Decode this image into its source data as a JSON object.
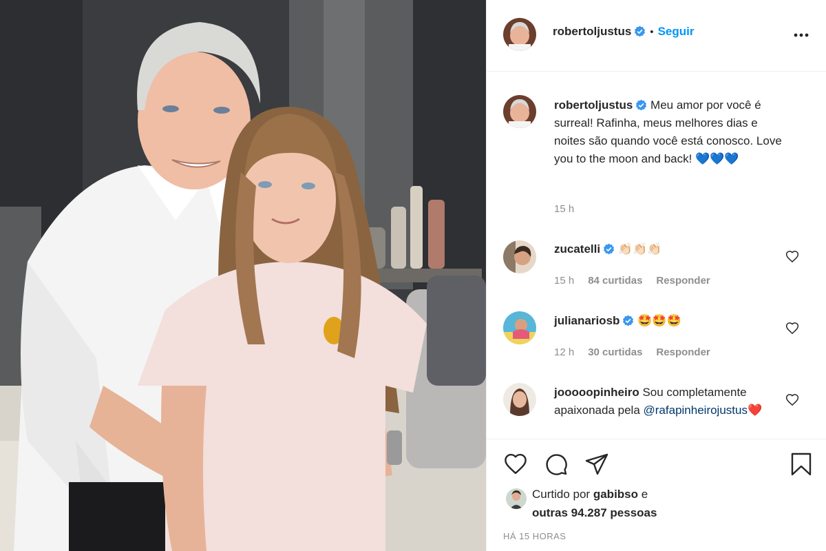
{
  "post": {
    "author": "robertoljustus",
    "follow_label": "Seguir",
    "separator": "•",
    "caption": "Meu amor por você é surreal! Rafinha, meus melhores dias e noites são quando você está conosco. Love you to the moon and back! 💙💙💙",
    "caption_time": "15 h"
  },
  "comments": [
    {
      "username": "zucatelli",
      "text": "👏🏻👏🏻👏🏻",
      "time": "15 h",
      "likes": "84 curtidas",
      "reply_label": "Responder"
    },
    {
      "username": "julianariosb",
      "text": "🤩🤩🤩",
      "time": "12 h",
      "likes": "30 curtidas",
      "reply_label": "Responder"
    },
    {
      "username": "jooooopinheiro",
      "text": "Sou completamente apaixonada pela",
      "mention": "@rafapinheirojustus",
      "emoji": "❤️"
    }
  ],
  "likes": {
    "prefix": "Curtido por",
    "user": "gabibso",
    "joiner": "e",
    "others": "outras 94.287 pessoas"
  },
  "timestamp": "HÁ 15 HORAS",
  "icons": [
    "heart-icon",
    "comment-icon",
    "share-icon",
    "bookmark-icon",
    "more-options-icon",
    "verified-badge-icon"
  ],
  "colors": {
    "link": "#0095f6",
    "verified": "#3897f0",
    "meta": "#8e8e8e"
  }
}
